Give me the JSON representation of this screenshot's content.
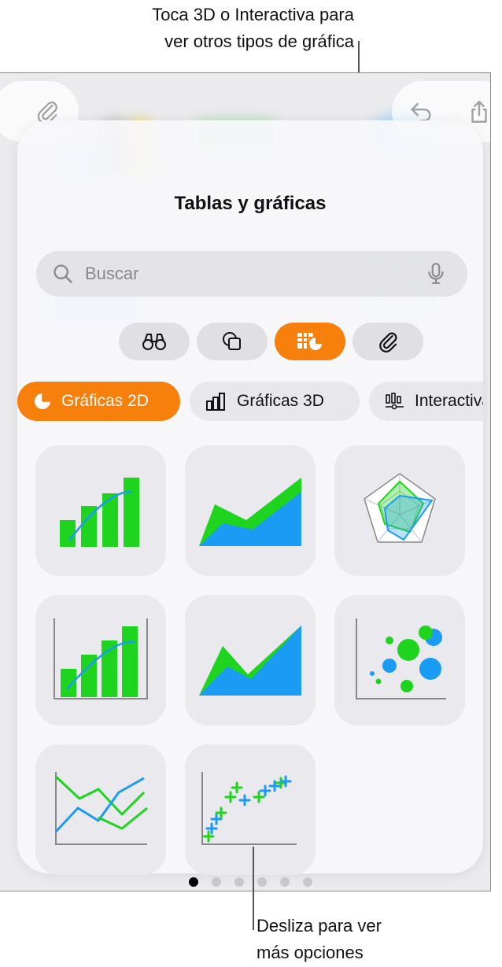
{
  "callouts": {
    "top_line1": "Toca 3D o Interactiva para",
    "top_line2": "ver otros tipos de gráfica",
    "bottom_line1": "Desliza para ver",
    "bottom_line2": "más opciones"
  },
  "toolbar": {
    "left_icon": "paperclip-icon",
    "right_icons": [
      "undo-icon",
      "share-icon"
    ]
  },
  "panel": {
    "title": "Tablas y gráficas",
    "search": {
      "placeholder": "Buscar",
      "value": ""
    },
    "categories": [
      {
        "icon": "binoculars-icon",
        "selected": false
      },
      {
        "icon": "shapes-icon",
        "selected": false
      },
      {
        "icon": "table-chart-icon",
        "selected": true
      },
      {
        "icon": "paperclip-icon",
        "selected": false
      }
    ],
    "subtabs": [
      {
        "label": "Gráficas 2D",
        "icon": "pie-chart-icon",
        "selected": true
      },
      {
        "label": "Gráficas 3D",
        "icon": "bar-3d-icon",
        "selected": false
      },
      {
        "label": "Interactiva",
        "icon": "interactive-chart-icon",
        "selected": false
      }
    ],
    "chart_types": [
      "bar-line-mixed-chart-icon",
      "stacked-area-chart-icon",
      "radar-chart-icon",
      "bar-line-two-axis-chart-icon",
      "area-chart-icon",
      "bubble-chart-icon",
      "line-chart-icon",
      "scatter-chart-icon"
    ],
    "pagination": {
      "current": 1,
      "total": 6
    }
  },
  "colors": {
    "accent": "#f77f0c",
    "chart_green": "#1ed41e",
    "chart_blue": "#1a9cf5"
  }
}
